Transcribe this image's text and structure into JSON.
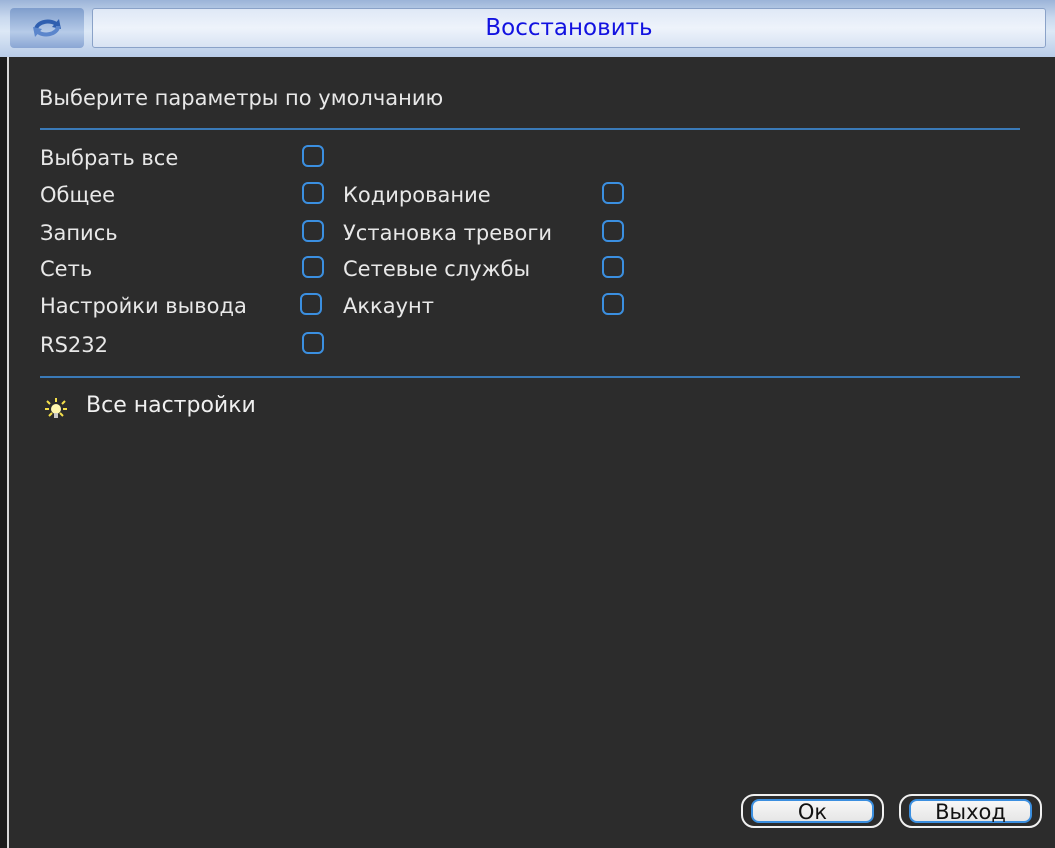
{
  "window": {
    "title": "Восстановить",
    "title_icon": "refresh-icon"
  },
  "prompt": "Выберите параметры по умолчанию",
  "options": {
    "select_all": "Выбрать все",
    "general": "Общее",
    "encoding": "Кодирование",
    "record": "Запись",
    "alarm_setup": "Установка тревоги",
    "network": "Сеть",
    "network_services": "Сетевые службы",
    "output_settings": "Настройки вывода",
    "account": "Аккаунт",
    "rs232": "RS232"
  },
  "hint": {
    "icon": "lightbulb-icon",
    "text": "Все настройки"
  },
  "buttons": {
    "ok": "Ок",
    "exit": "Выход"
  },
  "colors": {
    "title_text": "#1212e0",
    "accent": "#3b8fe0",
    "background": "#2c2c2c"
  }
}
